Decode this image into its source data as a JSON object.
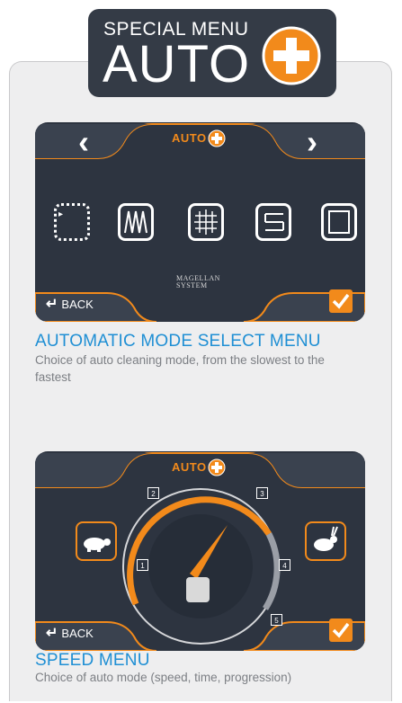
{
  "header": {
    "subtitle": "SPECIAL MENU",
    "title": "AUTO",
    "plus_icon": "orange-plus-circle-icon"
  },
  "colors": {
    "accent": "#f28a1b",
    "screen": "#2d3440",
    "caption_blue": "#1f8fd4"
  },
  "mode_menu": {
    "screen_title": "AUTO",
    "back_label": "BACK",
    "logo_lines": [
      "MAGELLAN",
      "SYSTEM"
    ],
    "modes": [
      "corner-start-icon",
      "zigzag-icon",
      "grid-cross-icon",
      "loop-lanes-icon",
      "perimeter-icon"
    ],
    "caption_title": "AUTOMATIC MODE SELECT MENU",
    "caption_desc": "Choice of auto cleaning mode, from the slowest to the fastest"
  },
  "speed_menu": {
    "screen_title": "AUTO",
    "back_label": "BACK",
    "speed_steps": [
      "1",
      "2",
      "3",
      "4",
      "5"
    ],
    "level": 3,
    "caption_title": "SPEED MENU",
    "caption_desc": "Choice of auto mode (speed, time, progression)"
  }
}
